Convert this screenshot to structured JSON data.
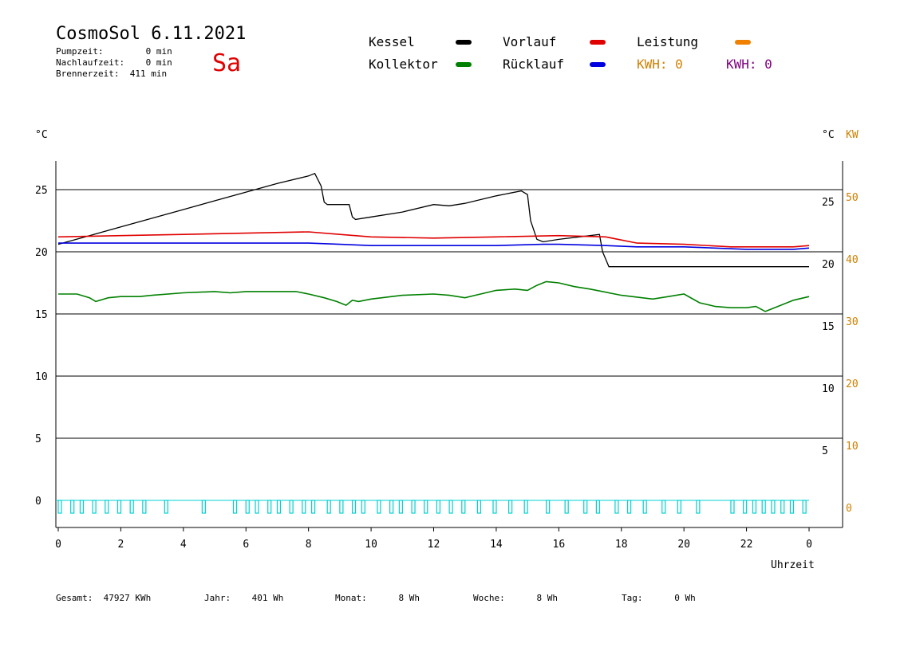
{
  "header": {
    "title": "CosmoSol 6.11.2021",
    "day": "Sa",
    "pumpzeit": "Pumpzeit:        0 min",
    "nachlaufzeit": "Nachlaufzeit:    0 min",
    "brennerzeit": "Brennerzeit:  411 min"
  },
  "legend": {
    "kessel": "Kessel",
    "kollektor": "Kollektor",
    "vorlauf": "Vorlauf",
    "ruecklauf": "Rücklauf",
    "leistung": "Leistung",
    "kwh1": "KWH: 0",
    "kwh2": "KWH: 0"
  },
  "colors": {
    "kessel": "#000000",
    "kollektor": "#008000",
    "vorlauf": "#e00000",
    "ruecklauf": "#0000e0",
    "leistung": "#f08000",
    "kwh2": "#800080",
    "pump": "#00d0d0",
    "axis_kw": "#d08000"
  },
  "axes": {
    "left_unit": "°C",
    "right_unit": "°C",
    "kw_unit": "KW",
    "xlabel": "Uhrzeit"
  },
  "footer": {
    "gesamt": "Gesamt:  47927 KWh",
    "jahr": "Jahr:    401 Wh",
    "monat": "Monat:      8 Wh",
    "woche": "Woche:      8 Wh",
    "tag": "Tag:      0 Wh"
  },
  "chart_data": {
    "type": "line",
    "xlabel": "Uhrzeit",
    "xticks": [
      "0",
      "2",
      "4",
      "6",
      "8",
      "10",
      "12",
      "14",
      "16",
      "18",
      "20",
      "22",
      "0"
    ],
    "xlim": [
      0,
      24
    ],
    "ylim": [
      -2.2,
      27.5
    ],
    "yticks_left": [
      "0",
      "5",
      "10",
      "15",
      "20",
      "25"
    ],
    "yticks_right_temp": [
      "5",
      "10",
      "15",
      "20",
      "25"
    ],
    "yticks_right_kw": [
      "0",
      "10",
      "20",
      "30",
      "40",
      "50"
    ],
    "grid": true,
    "series": [
      {
        "name": "Kessel",
        "x": [
          0,
          1.0,
          2.0,
          3.0,
          4.0,
          5.0,
          6.0,
          7.0,
          8.0,
          8.2,
          8.4,
          8.5,
          8.6,
          9.0,
          9.3,
          9.4,
          9.5,
          10.0,
          11.0,
          12.0,
          12.5,
          13.0,
          14.0,
          14.8,
          15.0,
          15.1,
          15.3,
          15.5,
          16.0,
          17.0,
          17.3,
          17.4,
          17.6,
          18.0,
          20.0,
          22.0,
          24.0
        ],
        "y": [
          20.6,
          21.3,
          22.0,
          22.7,
          23.4,
          24.1,
          24.8,
          25.5,
          26.1,
          26.3,
          25.3,
          24.0,
          23.8,
          23.8,
          23.8,
          22.8,
          22.6,
          22.8,
          23.2,
          23.8,
          23.7,
          23.9,
          24.5,
          24.9,
          24.6,
          22.5,
          21.0,
          20.8,
          21.0,
          21.3,
          21.4,
          20.0,
          18.8,
          18.8,
          18.8,
          18.8,
          18.8
        ]
      },
      {
        "name": "Vorlauf",
        "x": [
          0,
          2,
          4,
          6,
          8,
          9,
          10,
          12,
          14,
          16,
          17.5,
          18.5,
          20,
          21.5,
          22.5,
          23.5,
          24
        ],
        "y": [
          21.2,
          21.3,
          21.4,
          21.5,
          21.6,
          21.4,
          21.2,
          21.1,
          21.2,
          21.3,
          21.2,
          20.7,
          20.6,
          20.4,
          20.4,
          20.4,
          20.5
        ]
      },
      {
        "name": "Rücklauf",
        "x": [
          0,
          2,
          4,
          6,
          8,
          9,
          10,
          12,
          14,
          15.5,
          16,
          17.5,
          18.5,
          20,
          22,
          23.5,
          24
        ],
        "y": [
          20.7,
          20.7,
          20.7,
          20.7,
          20.7,
          20.6,
          20.5,
          20.5,
          20.5,
          20.6,
          20.6,
          20.5,
          20.4,
          20.4,
          20.2,
          20.2,
          20.3
        ]
      },
      {
        "name": "Kollektor",
        "x": [
          0,
          0.6,
          1.0,
          1.2,
          1.6,
          2.0,
          2.6,
          3.0,
          4.0,
          5.0,
          5.5,
          6.0,
          7.0,
          7.6,
          8.0,
          8.5,
          8.9,
          9.2,
          9.4,
          9.6,
          10.0,
          11.0,
          12.0,
          12.5,
          13.0,
          13.5,
          14.0,
          14.6,
          15.0,
          15.3,
          15.6,
          16.0,
          16.5,
          17.0,
          18.0,
          19.0,
          19.5,
          20.0,
          20.5,
          21.0,
          21.5,
          22.0,
          22.3,
          22.6,
          23.0,
          23.5,
          24.0
        ],
        "y": [
          16.6,
          16.6,
          16.3,
          16.0,
          16.3,
          16.4,
          16.4,
          16.5,
          16.7,
          16.8,
          16.7,
          16.8,
          16.8,
          16.8,
          16.6,
          16.3,
          16.0,
          15.7,
          16.1,
          16.0,
          16.2,
          16.5,
          16.6,
          16.5,
          16.3,
          16.6,
          16.9,
          17.0,
          16.9,
          17.3,
          17.6,
          17.5,
          17.2,
          17.0,
          16.5,
          16.2,
          16.4,
          16.6,
          15.9,
          15.6,
          15.5,
          15.5,
          15.6,
          15.2,
          15.6,
          16.1,
          16.4
        ]
      }
    ],
    "pump_activity": {
      "name": "Pumpe",
      "y": 0,
      "times": [
        0.0,
        0.4,
        0.7,
        1.1,
        1.5,
        1.9,
        2.3,
        2.7,
        3.4,
        4.6,
        5.6,
        6.0,
        6.3,
        6.7,
        7.0,
        7.4,
        7.8,
        8.1,
        8.6,
        9.0,
        9.4,
        9.7,
        10.2,
        10.6,
        10.9,
        11.3,
        11.7,
        12.1,
        12.5,
        12.9,
        13.4,
        13.9,
        14.4,
        14.9,
        15.6,
        16.2,
        16.8,
        17.2,
        17.8,
        18.2,
        18.7,
        19.3,
        19.8,
        20.4,
        21.5,
        21.9,
        22.2,
        22.5,
        22.8,
        23.1,
        23.4,
        23.8
      ]
    }
  }
}
